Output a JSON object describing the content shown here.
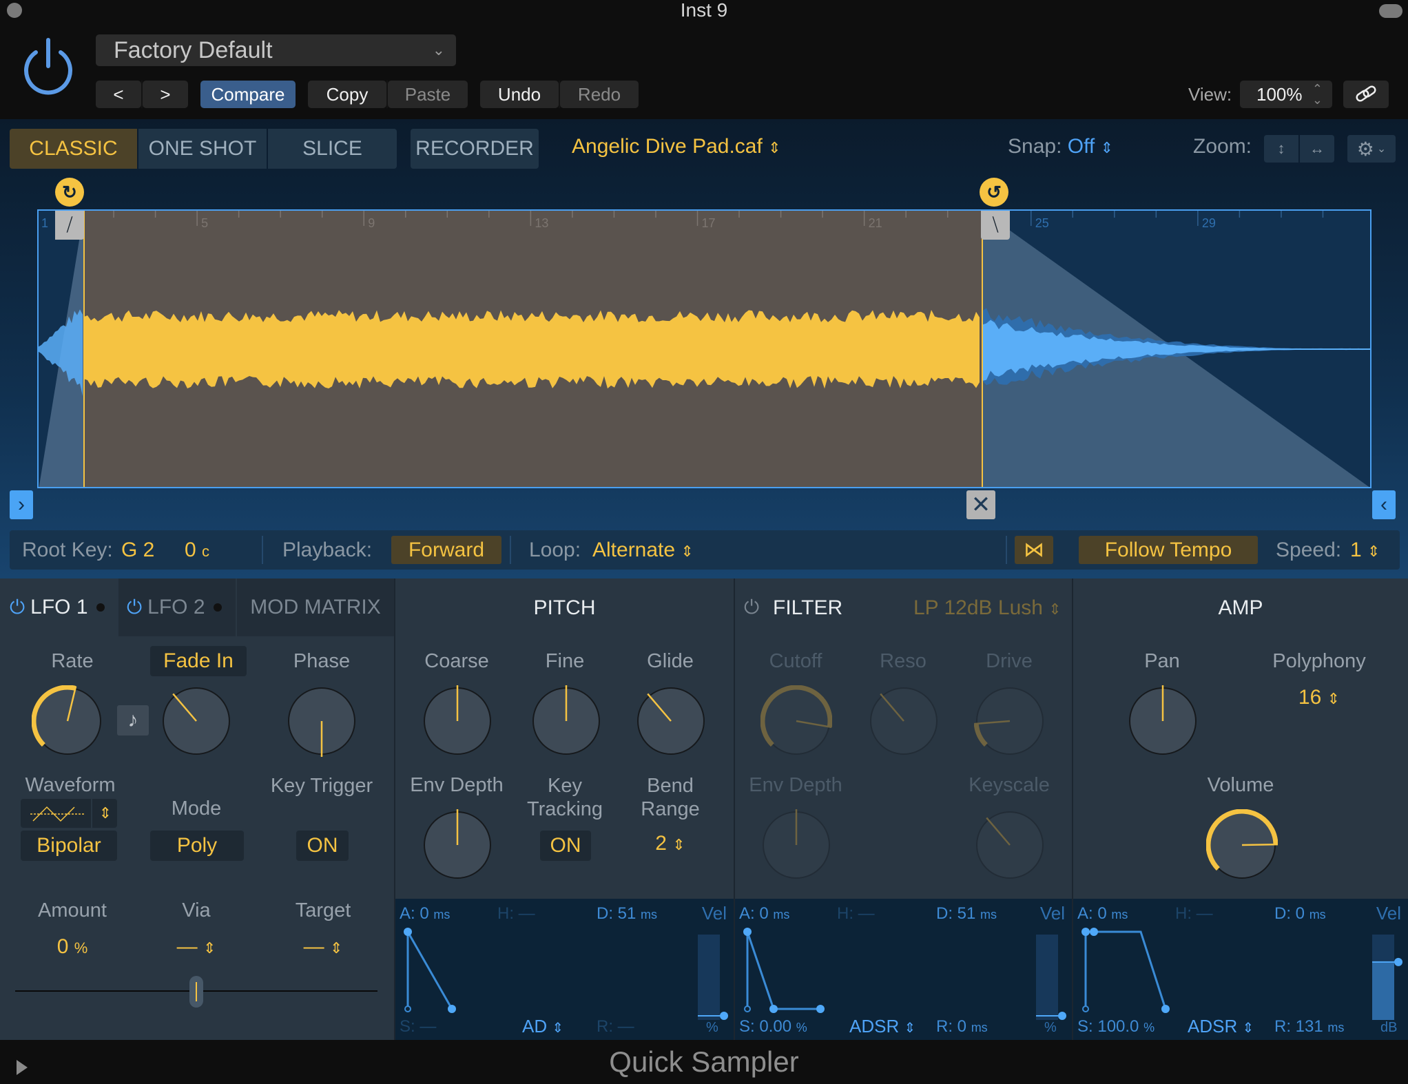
{
  "window": {
    "title": "Inst 9",
    "footer_title": "Quick Sampler"
  },
  "header": {
    "preset": "Factory Default",
    "prev_label": "<",
    "next_label": ">",
    "compare": "Compare",
    "copy": "Copy",
    "paste": "Paste",
    "undo": "Undo",
    "redo": "Redo",
    "view_label": "View:",
    "view_value": "100%",
    "colors": {
      "accent_blue": "#3a5e8c",
      "power": "#5b9ae6"
    }
  },
  "modes": {
    "tabs": [
      {
        "label": "CLASSIC",
        "active": true
      },
      {
        "label": "ONE SHOT",
        "active": false
      },
      {
        "label": "SLICE",
        "active": false
      }
    ],
    "recorder": "RECORDER",
    "file_name": "Angelic Dive Pad.caf",
    "snap_label": "Snap:",
    "snap_value": "Off",
    "zoom_label": "Zoom:"
  },
  "waveform": {
    "ruler": [
      "1",
      "5",
      "9",
      "13",
      "17",
      "21",
      "25",
      "29"
    ],
    "loop_start_bar": 2,
    "loop_end_bar": 24,
    "total_bars": 32,
    "colors": {
      "loop_wave": "#f5c342",
      "outer_wave": "#5aaef7",
      "loop_bg": "#5a534e",
      "box_border": "#4a9ff0"
    }
  },
  "params": {
    "root_key_label": "Root Key:",
    "root_key": "G 2",
    "tune": "0",
    "tune_unit": "c",
    "playback_label": "Playback:",
    "playback": "Forward",
    "loop_label": "Loop:",
    "loop": "Alternate",
    "follow_tempo": "Follow Tempo",
    "speed_label": "Speed:",
    "speed": "1"
  },
  "lfo": {
    "tabs": [
      "LFO 1",
      "LFO 2",
      "MOD MATRIX"
    ],
    "rate_label": "Rate",
    "fade_label": "Fade In",
    "phase_label": "Phase",
    "waveform_label": "Waveform",
    "mode_label": "Mode",
    "key_trigger_label": "Key Trigger",
    "polarity": "Bipolar",
    "mode": "Poly",
    "key_trigger": "ON",
    "amount_label": "Amount",
    "amount": "0",
    "amount_unit": "%",
    "via_label": "Via",
    "via": "—",
    "target_label": "Target",
    "target": "—",
    "knobs": {
      "rate": 0.55,
      "fade": 0.35,
      "phase": 0.0
    },
    "amount_slider": 0.5
  },
  "pitch": {
    "title": "PITCH",
    "coarse_label": "Coarse",
    "fine_label": "Fine",
    "glide_label": "Glide",
    "env_depth_label": "Env Depth",
    "key_tracking_label": "Key Tracking",
    "key_tracking": "ON",
    "bend_label": "Bend Range",
    "bend": "2",
    "knobs": {
      "coarse": 0.5,
      "fine": 0.5,
      "glide": 0.35,
      "env_depth": 0.5
    },
    "env": {
      "a": "0",
      "h": "—",
      "d": "51",
      "s": "—",
      "r": "—",
      "mode": "AD",
      "vel_unit": "%",
      "vel": 0.0
    }
  },
  "filter": {
    "title": "FILTER",
    "type": "LP 12dB Lush",
    "cutoff_label": "Cutoff",
    "reso_label": "Reso",
    "drive_label": "Drive",
    "env_depth_label": "Env Depth",
    "keyscale_label": "Keyscale",
    "knobs": {
      "cutoff": 0.87,
      "reso": 0.35,
      "drive": 0.15,
      "env_depth": 0.5,
      "keyscale": 0.35
    },
    "env": {
      "a": "0",
      "h": "—",
      "d": "51",
      "s": "0.00",
      "r": "0",
      "mode": "ADSR",
      "vel_unit": "%",
      "vel": 0.0
    }
  },
  "amp": {
    "title": "AMP",
    "pan_label": "Pan",
    "polyphony_label": "Polyphony",
    "polyphony": "16",
    "volume_label": "Volume",
    "knobs": {
      "pan": 0.5,
      "volume": 0.83
    },
    "env": {
      "a": "0",
      "h": "—",
      "d": "0",
      "s": "100.0",
      "r": "131",
      "mode": "ADSR",
      "vel_unit": "dB",
      "vel": 0.63
    }
  },
  "env_labels": {
    "a": "A:",
    "h": "H:",
    "d": "D:",
    "s": "S:",
    "r": "R:",
    "ms": "ms",
    "pct": "%",
    "vel": "Vel"
  }
}
